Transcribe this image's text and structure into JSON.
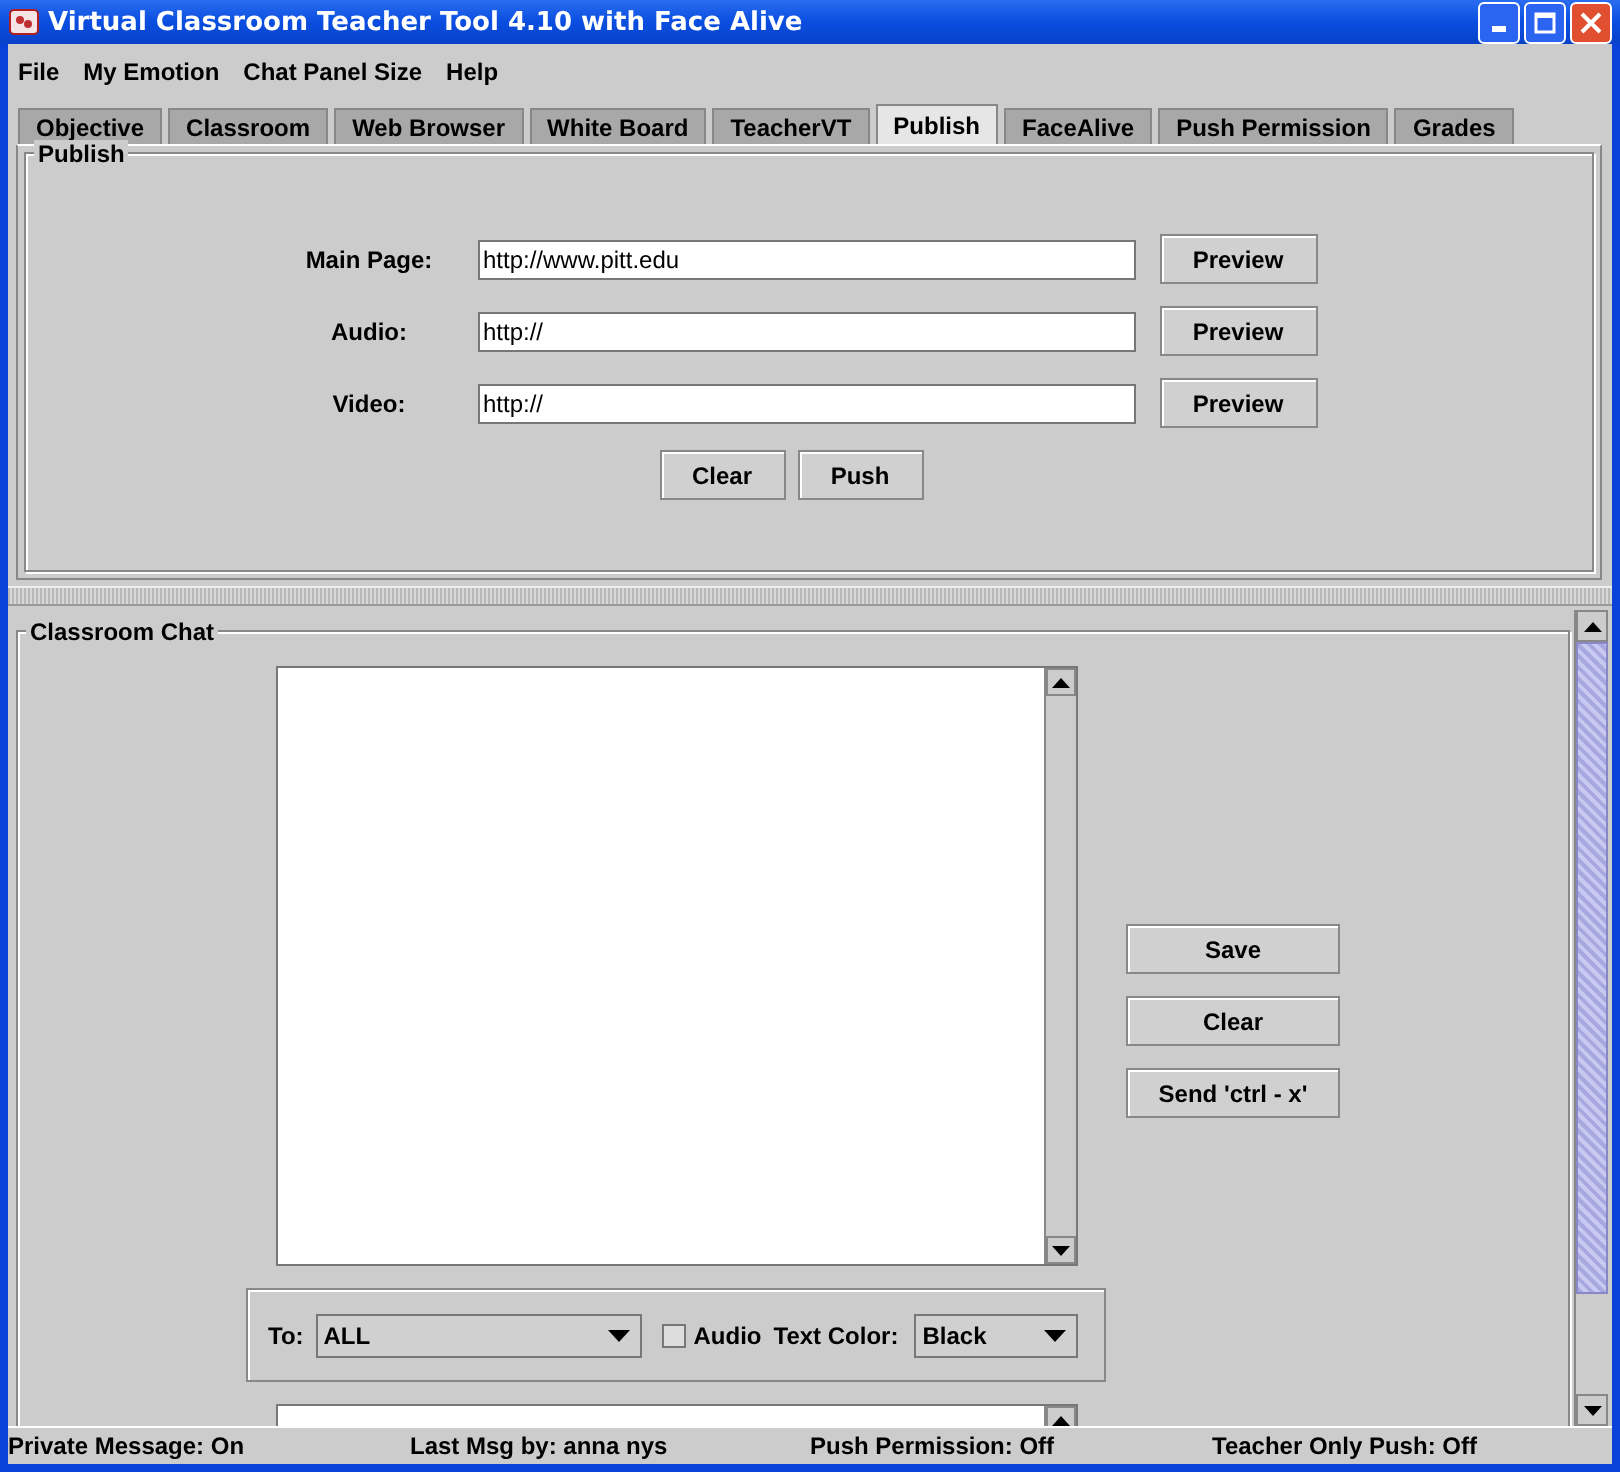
{
  "window": {
    "title": "Virtual Classroom Teacher Tool 4.10 with Face Alive"
  },
  "menu": [
    "File",
    "My Emotion",
    "Chat Panel Size",
    "Help"
  ],
  "tabs": [
    {
      "label": "Objective",
      "selected": false
    },
    {
      "label": "Classroom",
      "selected": false
    },
    {
      "label": "Web Browser",
      "selected": false
    },
    {
      "label": "White Board",
      "selected": false
    },
    {
      "label": "TeacherVT",
      "selected": false
    },
    {
      "label": "Publish",
      "selected": true
    },
    {
      "label": "FaceAlive",
      "selected": false
    },
    {
      "label": "Push Permission",
      "selected": false
    },
    {
      "label": "Grades",
      "selected": false
    }
  ],
  "publish": {
    "title": "Publish",
    "rows": [
      {
        "label": "Main Page:",
        "value": "http://www.pitt.edu",
        "button": "Preview"
      },
      {
        "label": "Audio:",
        "value": "http://",
        "button": "Preview"
      },
      {
        "label": "Video:",
        "value": "http://",
        "button": "Preview"
      }
    ],
    "buttons": [
      "Clear",
      "Push"
    ]
  },
  "chat": {
    "title": "Classroom Chat",
    "buttons": [
      "Save",
      "Clear",
      "Send 'ctrl - x'"
    ],
    "to_label": "To:",
    "to_value": "ALL",
    "audio": {
      "label": "Audio",
      "checked": false
    },
    "color_label": "Text Color:",
    "color_value": "Black"
  },
  "status_bar": [
    "Private Message: On",
    "Last Msg by: anna nys",
    "Push Permission: Off",
    "Teacher Only Push: Off"
  ]
}
